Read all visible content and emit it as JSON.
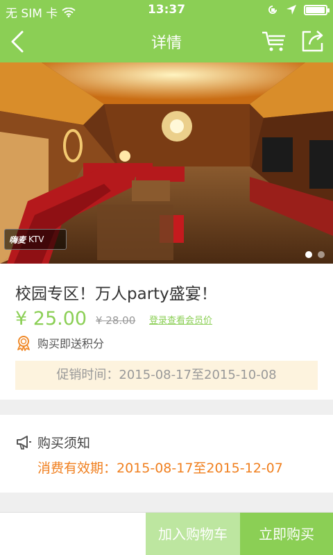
{
  "status_bar": {
    "carrier": "无 SIM 卡",
    "time": "13:37",
    "battery_level": 0.95
  },
  "nav": {
    "title": "详情",
    "icons": [
      "back-icon",
      "cart-icon",
      "share-icon"
    ]
  },
  "hero": {
    "logo_text": "嗨麦",
    "logo_sub": "KTV",
    "slides_total": 2,
    "active_slide": 1
  },
  "product": {
    "title": "校园专区！万人party盛宴！",
    "price": "¥ 25.00",
    "original_price": "¥ 28.00",
    "member_link": "登录查看会员价",
    "points_text": "购买即送积分",
    "promo_text": "促销时间：2015-08-17至2015-10-08"
  },
  "notice": {
    "heading": "购买须知",
    "validity": "消费有效期：2015-08-17至2015-12-07"
  },
  "bottom": {
    "add_to_cart": "加入购物车",
    "buy_now": "立即购买"
  },
  "colors": {
    "brand_green": "#8bcf55",
    "light_green": "#bde6a0",
    "orange": "#f07f1e",
    "promo_bg": "#fdf3de"
  }
}
